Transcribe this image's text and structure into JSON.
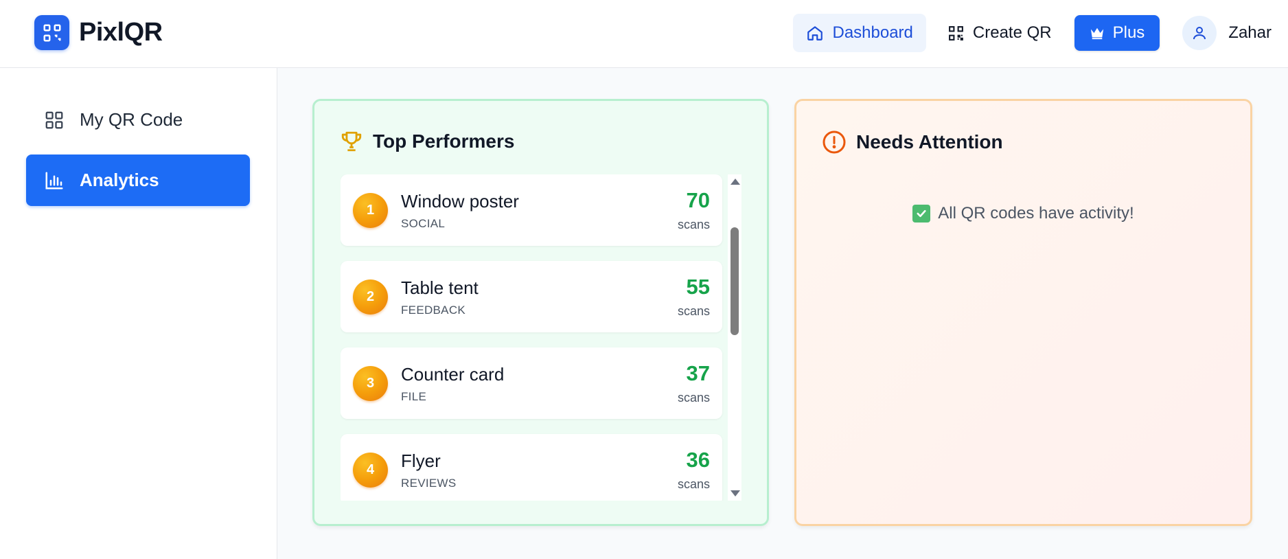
{
  "brand": {
    "name": "PixlQR",
    "accent": "#2563eb"
  },
  "header": {
    "nav": {
      "dashboard": "Dashboard",
      "create": "Create QR",
      "plus": "Plus"
    },
    "user": {
      "name": "Zahar"
    }
  },
  "sidebar": {
    "items": [
      {
        "label": "My QR Code",
        "icon": "grid-icon",
        "active": false
      },
      {
        "label": "Analytics",
        "icon": "bar-chart-icon",
        "active": true
      }
    ]
  },
  "top_performers": {
    "title": "Top Performers",
    "icon": "trophy-icon",
    "unit": "scans",
    "items": [
      {
        "rank": "1",
        "name": "Window poster",
        "category": "SOCIAL",
        "scans": "70"
      },
      {
        "rank": "2",
        "name": "Table tent",
        "category": "FEEDBACK",
        "scans": "55"
      },
      {
        "rank": "3",
        "name": "Counter card",
        "category": "FILE",
        "scans": "37"
      },
      {
        "rank": "4",
        "name": "Flyer",
        "category": "REVIEWS",
        "scans": "36"
      }
    ]
  },
  "needs_attention": {
    "title": "Needs Attention",
    "icon": "alert-circle-icon",
    "message": "All QR codes have activity!"
  },
  "colors": {
    "primary": "#1d6cf5",
    "success": "#16a34a",
    "warning": "#ea580c",
    "trophy": "#e0a100"
  }
}
